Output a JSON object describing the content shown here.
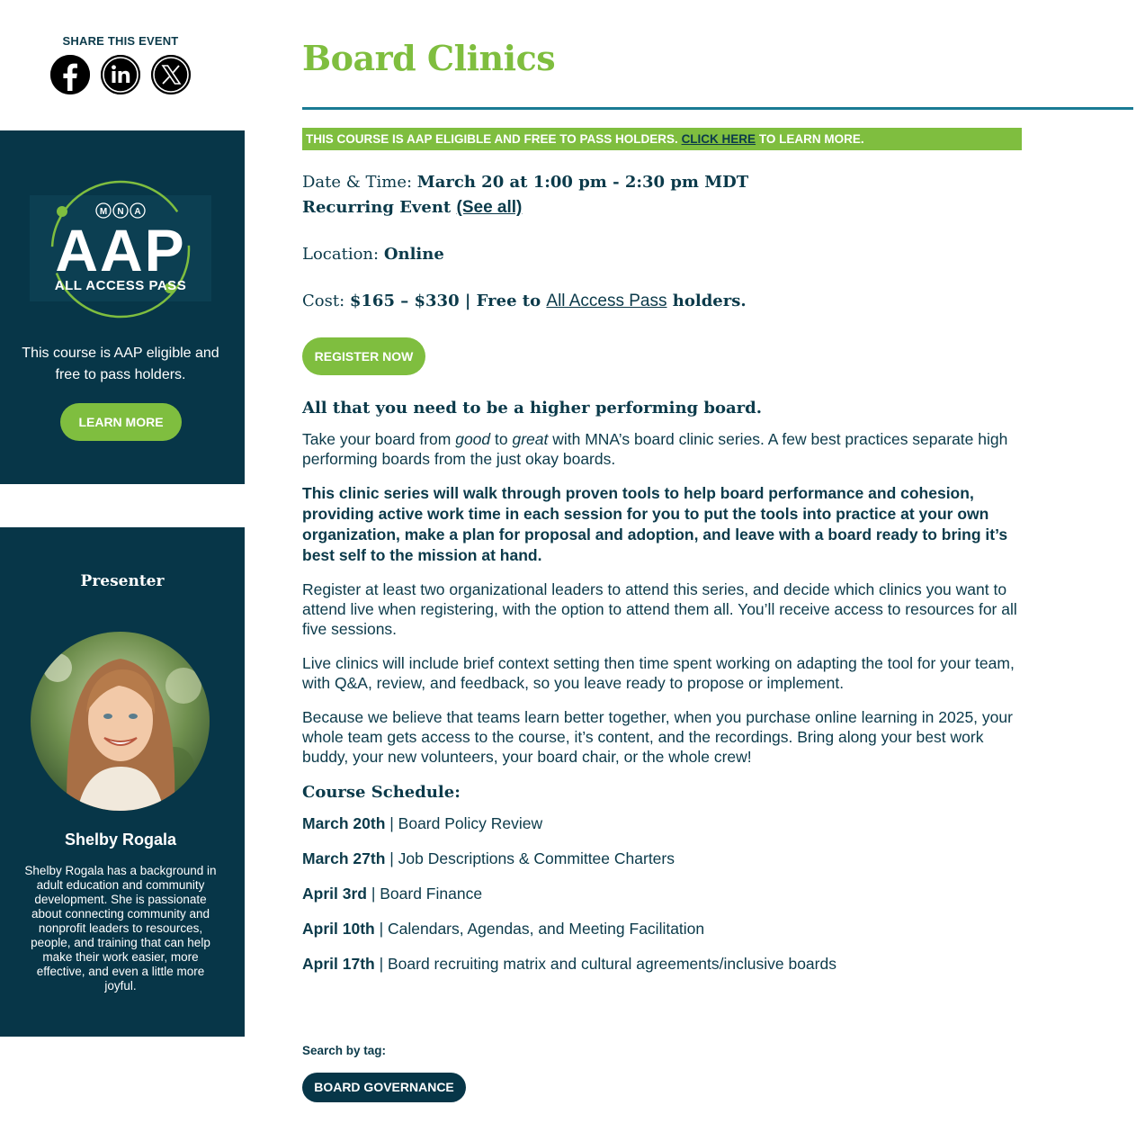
{
  "share": {
    "title": "SHARE THIS EVENT",
    "icons": [
      "facebook-icon",
      "linkedin-icon",
      "x-icon"
    ]
  },
  "aap_panel": {
    "logo_org": "M·N·A",
    "logo_big": "AAP",
    "logo_sub": "ALL ACCESS PASS",
    "text": "This course is AAP eligible and free to pass holders.",
    "button": "LEARN MORE"
  },
  "presenter": {
    "heading": "Presenter",
    "name": "Shelby Rogala",
    "bio": "Shelby Rogala has a background in adult education and community development. She is passionate about connecting community and nonprofit leaders to resources, people, and training that can help make their work easier, more effective, and even a little more joyful."
  },
  "event": {
    "title": "Board Clinics",
    "banner": {
      "before": "THIS COURSE IS AAP ELIGIBLE AND FREE TO PASS HOLDERS. ",
      "link": "CLICK HERE",
      "after": " TO LEARN MORE."
    },
    "datetime_label": "Date & Time: ",
    "datetime_value": "March 20 at 1:00 pm - 2:30 pm MDT",
    "recurring_label": "Recurring Event ",
    "recurring_link": "(See all)",
    "location_label": "Location: ",
    "location_value": "Online",
    "cost_label": "Cost: ",
    "cost_value": "$165 – $330 | Free to ",
    "cost_link": "All Access Pass",
    "cost_after": " holders.",
    "register_button": "REGISTER NOW"
  },
  "content": {
    "headline": "All that you need to be a higher performing board.",
    "intro_1": "Take your board from ",
    "intro_good": "good",
    "intro_2": " to ",
    "intro_great": "great",
    "intro_3": " with MNA’s board clinic series. A few best practices separate high performing boards from the just okay boards.",
    "bold_paragraph": "This clinic series will walk through proven tools to help board performance and cohesion, providing active work time in each session for you to put the tools into practice at your own organization, make a plan for proposal and adoption, and leave with a board ready to bring it’s best self to the mission at hand.",
    "paragraph_register": "Register at least two organizational leaders to attend this series, and decide which clinics you want to attend live when registering, with the option to attend them all. You’ll receive access to resources for all five sessions.",
    "paragraph_live": "Live clinics will include brief context setting then time spent working on adapting the tool for your team, with Q&A, review, and feedback, so you leave ready to propose or implement.",
    "paragraph_team": "Because we believe that teams learn better together, when you purchase online learning in 2025, your whole team gets access to the course, it’s content, and the recordings. Bring along your best work buddy, your new volunteers, your board chair, or the whole crew!",
    "schedule_heading": "Course Schedule:",
    "schedule": [
      {
        "date": "March 20th",
        "topic": " | Board Policy Review"
      },
      {
        "date": "March 27th",
        "topic": " | Job Descriptions & Committee Charters"
      },
      {
        "date": "April 3rd",
        "topic": " | Board Finance"
      },
      {
        "date": "April 10th",
        "topic": " | Calendars, Agendas, and Meeting Facilitation"
      },
      {
        "date": "April 17th",
        "topic": " | Board recruiting matrix and cultural agreements/inclusive boards"
      }
    ]
  },
  "tags": {
    "label": "Search by tag:",
    "items": [
      "BOARD GOVERNANCE"
    ]
  },
  "colors": {
    "brand_green": "#7fbe3f",
    "navy": "#073648",
    "text": "#0b3a4a",
    "rule": "#1a7b94"
  }
}
